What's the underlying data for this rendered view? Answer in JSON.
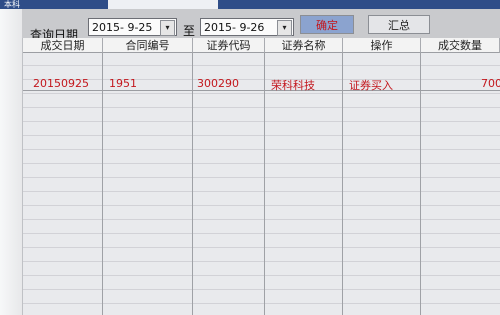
{
  "window": {
    "title_tab": "本科",
    "title_field": ""
  },
  "query": {
    "label": "查询日期",
    "from_date": "2015- 9-25",
    "to_label": "至",
    "to_date": "2015- 9-26",
    "dropdown_glyph": "▾"
  },
  "toolbar": {
    "confirm_label": "确定",
    "summary_label": "汇总"
  },
  "table": {
    "columns": [
      "成交日期",
      "合同编号",
      "证券代码",
      "证券名称",
      "操作",
      "成交数量"
    ],
    "rows": [
      [
        "20150925",
        "1951",
        "300290",
        "荣科科技",
        "证券买入",
        "700"
      ]
    ]
  },
  "colors": {
    "text_accent": "#c3161c",
    "confirm_button": "#8ba3cf",
    "title_bar": "#2f4d88"
  }
}
